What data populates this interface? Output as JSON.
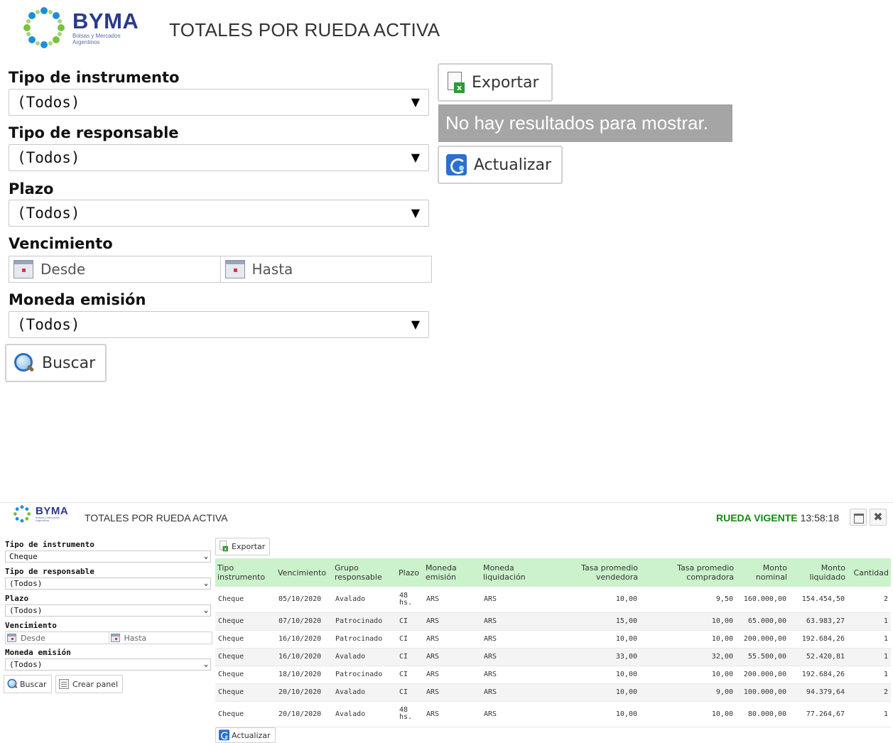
{
  "brand": {
    "name": "BYMA",
    "subtitle": "Bolsas y Mercados Argentinos"
  },
  "title": "TOTALES POR RUEDA ACTIVA",
  "zoomed_panel": {
    "filters": {
      "tipo_instrumento": {
        "label": "Tipo de instrumento",
        "value": "(Todos)"
      },
      "tipo_responsable": {
        "label": "Tipo de responsable",
        "value": "(Todos)"
      },
      "plazo": {
        "label": "Plazo",
        "value": "(Todos)"
      },
      "vencimiento": {
        "label": "Vencimiento",
        "desde": "Desde",
        "hasta": "Hasta"
      },
      "moneda_emision": {
        "label": "Moneda emisión",
        "value": "(Todos)"
      }
    },
    "buscar_label": "Buscar",
    "exportar_label": "Exportar",
    "no_results": "No hay resultados para mostrar.",
    "actualizar_label": "Actualizar"
  },
  "main_panel": {
    "rueda_label": "RUEDA VIGENTE",
    "rueda_time": "13:58:18",
    "filters": {
      "tipo_instrumento": {
        "label": "Tipo de instrumento",
        "value": "Cheque"
      },
      "tipo_responsable": {
        "label": "Tipo de responsable",
        "value": "(Todos)"
      },
      "plazo": {
        "label": "Plazo",
        "value": "(Todos)"
      },
      "vencimiento": {
        "label": "Vencimiento",
        "desde": "Desde",
        "hasta": "Hasta"
      },
      "moneda_emision": {
        "label": "Moneda emisión",
        "value": "(Todos)"
      }
    },
    "buscar_label": "Buscar",
    "crear_panel_label": "Crear panel",
    "exportar_label": "Exportar",
    "actualizar_label": "Actualizar",
    "table": {
      "columns": [
        "Tipo instrumento",
        "Vencimiento",
        "Grupo responsable",
        "Plazo",
        "Moneda emisión",
        "Moneda liquidación",
        "Tasa promedio vendedora",
        "Tasa promedio compradora",
        "Monto nominal",
        "Monto liquidado",
        "Cantidad"
      ],
      "rows": [
        [
          "Cheque",
          "05/10/2020",
          "Avalado",
          "48 hs.",
          "ARS",
          "ARS",
          "10,00",
          "9,50",
          "160.000,00",
          "154.454,50",
          "2"
        ],
        [
          "Cheque",
          "07/10/2020",
          "Patrocinado",
          "CI",
          "ARS",
          "ARS",
          "15,00",
          "10,00",
          "65.000,00",
          "63.983,27",
          "1"
        ],
        [
          "Cheque",
          "16/10/2020",
          "Patrocinado",
          "CI",
          "ARS",
          "ARS",
          "10,00",
          "10,00",
          "200.000,00",
          "192.684,26",
          "1"
        ],
        [
          "Cheque",
          "16/10/2020",
          "Avalado",
          "CI",
          "ARS",
          "ARS",
          "33,00",
          "32,00",
          "55.500,00",
          "52.420,81",
          "1"
        ],
        [
          "Cheque",
          "18/10/2020",
          "Patrocinado",
          "CI",
          "ARS",
          "ARS",
          "10,00",
          "10,00",
          "200.000,00",
          "192.684,26",
          "1"
        ],
        [
          "Cheque",
          "20/10/2020",
          "Avalado",
          "CI",
          "ARS",
          "ARS",
          "10,00",
          "9,00",
          "100.000,00",
          "94.379,64",
          "2"
        ],
        [
          "Cheque",
          "20/10/2020",
          "Avalado",
          "48 hs.",
          "ARS",
          "ARS",
          "10,00",
          "10,00",
          "80.000,00",
          "77.264,67",
          "1"
        ]
      ]
    }
  },
  "icons": [
    "byma-logo-icon",
    "calendar-icon",
    "search-icon",
    "export-excel-icon",
    "refresh-icon",
    "panel-icon",
    "maximize-icon",
    "close-icon"
  ],
  "colors": {
    "brand_blue": "#2a3a8c",
    "rueda_green": "#138a13",
    "header_green": "#ccf2cc",
    "no_results_gray": "#a5a5a5"
  }
}
